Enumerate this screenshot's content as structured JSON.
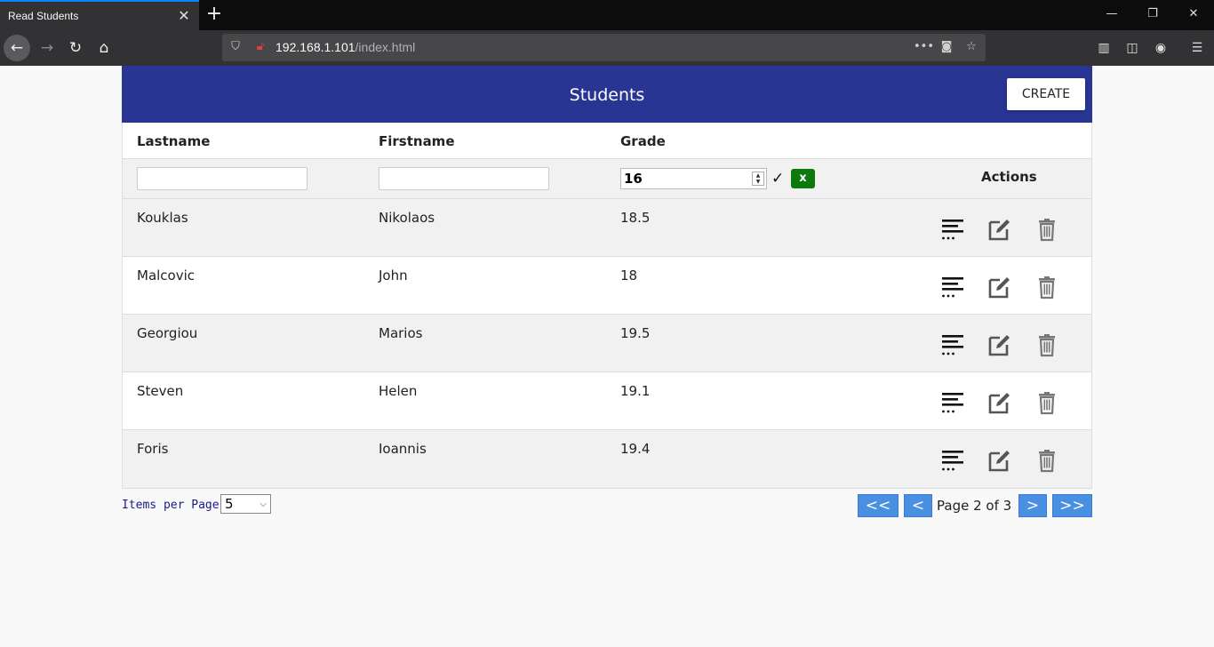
{
  "browser": {
    "tab_title": "Read Students",
    "url_host": "192.168.1.101",
    "url_path": "/index.html"
  },
  "header": {
    "title": "Students",
    "create_label": "CREATE"
  },
  "table": {
    "columns": [
      "Lastname",
      "Firstname",
      "Grade"
    ],
    "actions_label": "Actions",
    "filter": {
      "lastname": "",
      "firstname": "",
      "grade": "16"
    },
    "rows": [
      {
        "lastname": "Kouklas",
        "firstname": "Nikolaos",
        "grade": "18.5"
      },
      {
        "lastname": "Malcovic",
        "firstname": "John",
        "grade": "18"
      },
      {
        "lastname": "Georgiou",
        "firstname": "Marios",
        "grade": "19.5"
      },
      {
        "lastname": "Steven",
        "firstname": "Helen",
        "grade": "19.1"
      },
      {
        "lastname": "Foris",
        "firstname": "Ioannis",
        "grade": "19.4"
      }
    ]
  },
  "pagination": {
    "items_per_page_label": "Items per Page:",
    "items_per_page": "5",
    "first_label": "<<",
    "prev_label": "<",
    "page_text": "Page 2 of 3",
    "next_label": ">",
    "last_label": ">>"
  },
  "colors": {
    "header": "#283593",
    "pager": "#4a90e2",
    "clear": "#0a7a0a"
  }
}
